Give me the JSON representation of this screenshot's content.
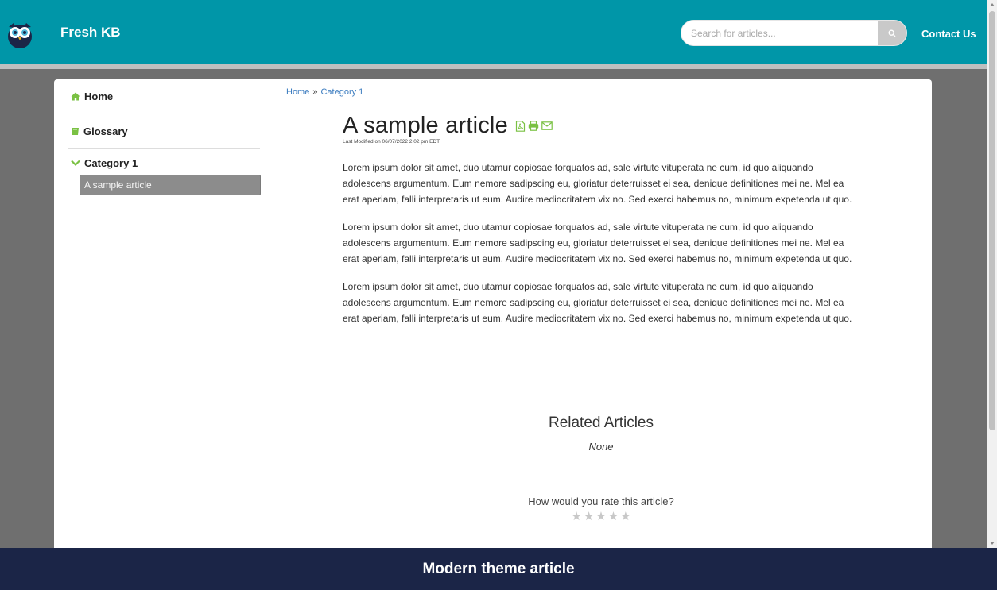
{
  "header": {
    "brand": "Fresh KB",
    "search_placeholder": "Search for articles...",
    "contact_label": "Contact Us",
    "accent_color": "#0096a8"
  },
  "sidebar": {
    "items": [
      {
        "label": "Home",
        "icon": "home-icon"
      },
      {
        "label": "Glossary",
        "icon": "book-icon"
      }
    ],
    "category": {
      "label": "Category 1",
      "icon": "chevron-down-icon",
      "sub_item": "A sample article"
    }
  },
  "breadcrumb": {
    "home": "Home",
    "separator": "»",
    "category": "Category 1"
  },
  "article": {
    "title": "A sample article",
    "modified": "Last Modified on 06/07/2022 2:02 pm EDT",
    "paragraphs": [
      "Lorem ipsum dolor sit amet, duo utamur copiosae torquatos ad, sale virtute vituperata ne cum, id quo aliquando adolescens argumentum. Eum nemore sadipscing eu, gloriatur deterruisset ei sea, denique definitiones mei ne. Mel ea erat aperiam, falli interpretaris ut eum. Audire mediocritatem vix no. Sed exerci habemus no, minimum expetenda ut quo.",
      "Lorem ipsum dolor sit amet, duo utamur copiosae torquatos ad, sale virtute vituperata ne cum, id quo aliquando adolescens argumentum. Eum nemore sadipscing eu, gloriatur deterruisset ei sea, denique definitiones mei ne. Mel ea erat aperiam, falli interpretaris ut eum. Audire mediocritatem vix no. Sed exerci habemus no, minimum expetenda ut quo.",
      "Lorem ipsum dolor sit amet, duo utamur copiosae torquatos ad, sale virtute vituperata ne cum, id quo aliquando adolescens argumentum. Eum nemore sadipscing eu, gloriatur deterruisset ei sea, denique definitiones mei ne. Mel ea erat aperiam, falli interpretaris ut eum. Audire mediocritatem vix no. Sed exerci habemus no, minimum expetenda ut quo."
    ],
    "action_icons": [
      "pdf-icon",
      "print-icon",
      "email-icon"
    ],
    "icon_color": "#7ac143"
  },
  "related": {
    "heading": "Related Articles",
    "none_text": "None"
  },
  "rating": {
    "question": "How would you rate this article?",
    "stars": [
      "★",
      "★",
      "★",
      "★",
      "★"
    ],
    "rating_value": 0
  },
  "banner": {
    "text": "Modern theme article"
  }
}
